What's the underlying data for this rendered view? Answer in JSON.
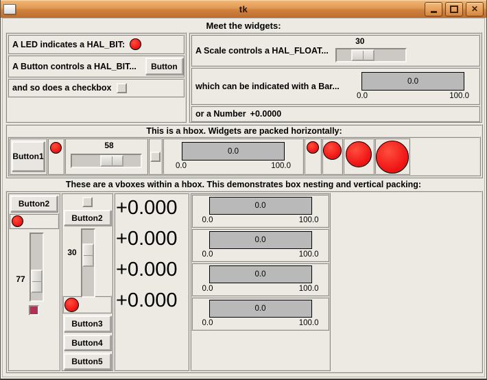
{
  "titlebar": {
    "title": "tk"
  },
  "header": {
    "title": "Meet the widgets:"
  },
  "intro": {
    "led_label": "A LED indicates a HAL_BIT:",
    "button_label": "A Button controls a HAL_BIT...",
    "button_text": "Button",
    "checkbox_label": "and so does a checkbox",
    "scale_label": "A Scale controls a HAL_FLOAT...",
    "scale_value": "30",
    "bar_label": "which can be indicated with a Bar...",
    "bar": {
      "value": "0.0",
      "min": "0.0",
      "max": "100.0"
    },
    "number_label": "or a Number",
    "number_value": "+0.0000"
  },
  "hbox": {
    "title": "This is a hbox. Widgets are packed horizontally:",
    "button": "Button1",
    "scale_value": "58",
    "bar": {
      "value": "0.0",
      "min": "0.0",
      "max": "100.0"
    }
  },
  "vboxes": {
    "title": "These are a vboxes within a hbox. This demonstrates box nesting and vertical packing:",
    "col1_button": "Button2",
    "col1_scale_value": "77",
    "col2_button": "Button2",
    "col2_scale_value": "30",
    "col2_button3": "Button3",
    "col2_button4": "Button4",
    "col2_button5": "Button5",
    "numbers": [
      "+0.000",
      "+0.000",
      "+0.000",
      "+0.000"
    ],
    "bars": [
      {
        "value": "0.0",
        "min": "0.0",
        "max": "100.0"
      },
      {
        "value": "0.0",
        "min": "0.0",
        "max": "100.0"
      },
      {
        "value": "0.0",
        "min": "0.0",
        "max": "100.0"
      },
      {
        "value": "0.0",
        "min": "0.0",
        "max": "100.0"
      }
    ]
  },
  "colors": {
    "led": "#ee1111",
    "checkbox_checked": "#b03056",
    "bar_fill": "#b9b9b9",
    "titlebar": "#d0823f"
  }
}
